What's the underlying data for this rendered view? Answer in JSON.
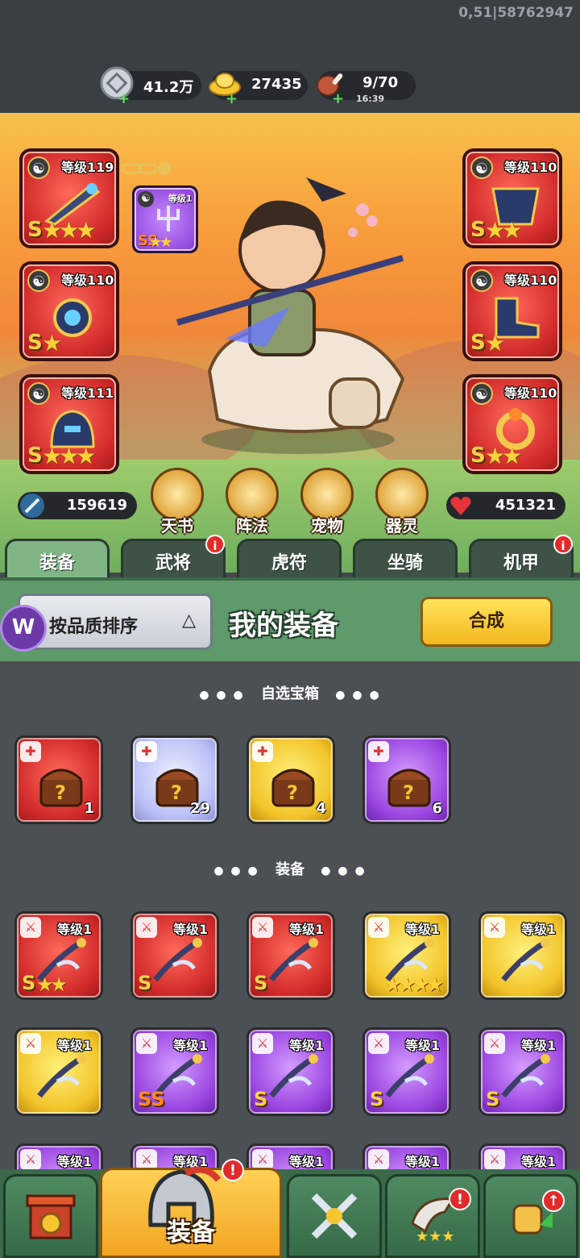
{
  "build_id": "0,51|58762947",
  "resources": {
    "silver": {
      "value": "41.2万",
      "icon": "silver-coin-icon"
    },
    "gold": {
      "value": "27435",
      "icon": "gold-ingot-icon"
    },
    "stamina": {
      "value": "9/70",
      "timer": "16:39",
      "icon": "meat-icon"
    }
  },
  "equipped": {
    "left": [
      {
        "level": "等级119",
        "grade": "S",
        "stars": "★★★"
      },
      {
        "level": "等级110",
        "grade": "S",
        "stars": "★"
      },
      {
        "level": "等级111",
        "grade": "S",
        "stars": "★★★"
      }
    ],
    "right": [
      {
        "level": "等级110",
        "grade": "S",
        "stars": "★★"
      },
      {
        "level": "等级110",
        "grade": "S",
        "stars": "★"
      },
      {
        "level": "等级110",
        "grade": "S",
        "stars": "★★"
      }
    ],
    "extra": {
      "level": "等级1",
      "grade": "SS",
      "stars": "★★"
    },
    "yinyang_symbol": "☯"
  },
  "stats": {
    "attack": "159619",
    "hp": "451321"
  },
  "features": [
    "天书",
    "阵法",
    "宠物",
    "器灵"
  ],
  "tabs": [
    {
      "label": "装备",
      "active": true,
      "badge": ""
    },
    {
      "label": "武将",
      "active": false,
      "badge": "i"
    },
    {
      "label": "虎符",
      "active": false,
      "badge": ""
    },
    {
      "label": "坐骑",
      "active": false,
      "badge": ""
    },
    {
      "label": "机甲",
      "active": false,
      "badge": "i"
    }
  ],
  "header": {
    "sort_label": "按品质排序",
    "sort_arrow": "△",
    "logo": "W",
    "title": "我的装备",
    "synth_label": "合成"
  },
  "sections": {
    "chest_title": "自选宝箱",
    "equip_title": "装备",
    "dots_left": "● ● ●",
    "dots_right": "● ● ●"
  },
  "chests": [
    {
      "rarity": "red",
      "count": "1"
    },
    {
      "rarity": "lilac",
      "count": "29"
    },
    {
      "rarity": "gold",
      "count": "4"
    },
    {
      "rarity": "purple",
      "count": "6"
    }
  ],
  "equipment": [
    {
      "rarity": "red",
      "level": "等级1",
      "grade": "S",
      "stars": "★★",
      "slot_icon": "sword-icon"
    },
    {
      "rarity": "red",
      "level": "等级1",
      "grade": "S",
      "stars": "",
      "slot_icon": "medal-icon"
    },
    {
      "rarity": "red",
      "level": "等级1",
      "grade": "S",
      "stars": "",
      "slot_icon": "armor-icon"
    },
    {
      "rarity": "gold",
      "level": "等级1",
      "grade": "",
      "stars": "★★★★",
      "slot_icon": "sword-icon"
    },
    {
      "rarity": "gold",
      "level": "等级1",
      "grade": "",
      "stars": "",
      "slot_icon": "sword-icon"
    },
    {
      "rarity": "gold",
      "level": "等级1",
      "grade": "",
      "stars": "",
      "slot_icon": "sword-icon"
    },
    {
      "rarity": "purple",
      "level": "等级1",
      "grade": "SS",
      "stars": "",
      "slot_icon": "sword-icon"
    },
    {
      "rarity": "purple",
      "level": "等级1",
      "grade": "S",
      "stars": "",
      "slot_icon": "sword-icon"
    },
    {
      "rarity": "purple",
      "level": "等级1",
      "grade": "S",
      "stars": "",
      "slot_icon": "sword-icon"
    },
    {
      "rarity": "purple",
      "level": "等级1",
      "grade": "S",
      "stars": "",
      "slot_icon": "sword-icon"
    },
    {
      "rarity": "purple",
      "level": "等级1",
      "grade": "",
      "stars": "",
      "slot_icon": "sword-icon"
    },
    {
      "rarity": "purple",
      "level": "等级1",
      "grade": "",
      "stars": "",
      "slot_icon": "sword-icon"
    },
    {
      "rarity": "purple",
      "level": "等级1",
      "grade": "",
      "stars": "",
      "slot_icon": "sword-icon"
    },
    {
      "rarity": "purple",
      "level": "等级1",
      "grade": "",
      "stars": "",
      "slot_icon": "sword-icon"
    },
    {
      "rarity": "purple",
      "level": "等级1",
      "grade": "",
      "stars": "",
      "slot_icon": "sword-icon"
    }
  ],
  "bottom_nav": {
    "active_label": "装备",
    "alert": "!",
    "items": [
      "shop-gate-icon",
      "helmet-icon",
      "crossed-swords-icon",
      "horn-icon",
      "fist-upgrade-icon"
    ]
  },
  "colors": {
    "accent_gold": "#f3b71f",
    "badge_red": "#e32a2a",
    "panel_green": "#5f9a6a"
  }
}
